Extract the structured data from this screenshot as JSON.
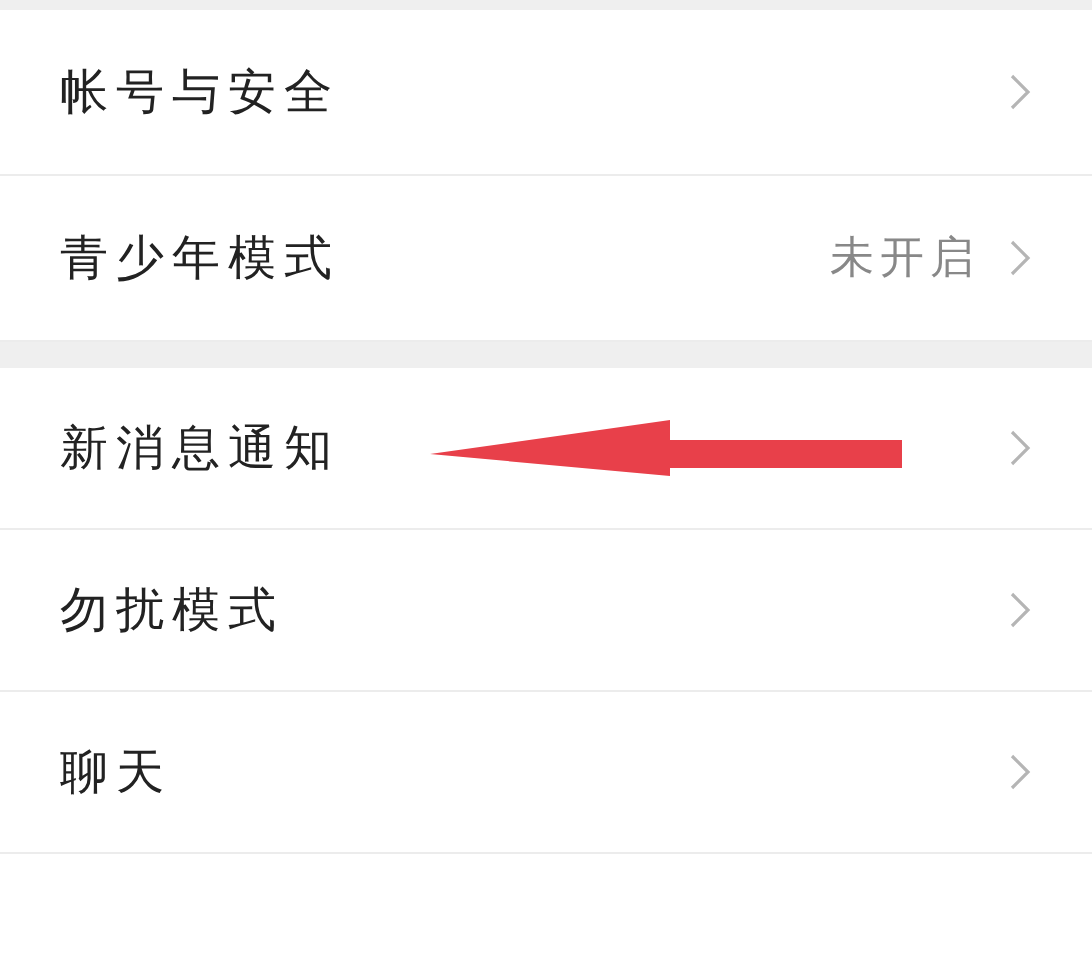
{
  "sections": [
    {
      "items": [
        {
          "label": "帐号与安全"
        },
        {
          "label": "青少年模式",
          "value": "未开启"
        }
      ]
    },
    {
      "items": [
        {
          "label": "新消息通知",
          "pointed": true
        },
        {
          "label": "勿扰模式"
        },
        {
          "label": "聊天"
        }
      ]
    }
  ]
}
